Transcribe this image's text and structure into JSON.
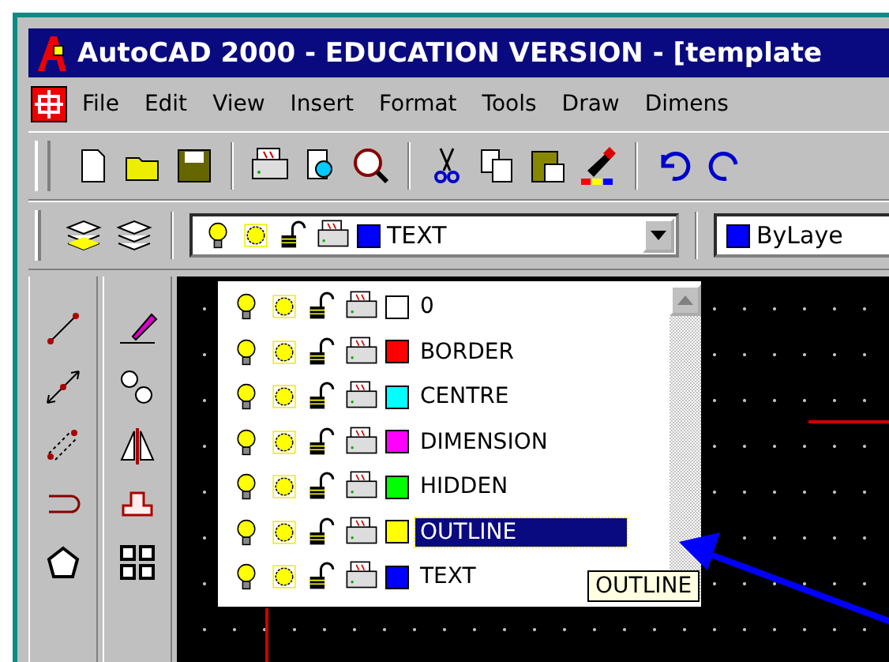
{
  "window": {
    "title": "AutoCAD 2000 - EDUCATION VERSION - [template"
  },
  "menu": [
    "File",
    "Edit",
    "View",
    "Insert",
    "Format",
    "Tools",
    "Draw",
    "Dimens"
  ],
  "layer_control": {
    "current": {
      "name": "TEXT",
      "color": "#0000ff"
    },
    "color_control": "ByLaye"
  },
  "layers": [
    {
      "name": "0",
      "color": "#ffffff",
      "selected": false
    },
    {
      "name": "BORDER",
      "color": "#ff0000",
      "selected": false
    },
    {
      "name": "CENTRE",
      "color": "#00ffff",
      "selected": false
    },
    {
      "name": "DIMENSION",
      "color": "#ff00ff",
      "selected": false
    },
    {
      "name": "HIDDEN",
      "color": "#00ff00",
      "selected": false
    },
    {
      "name": "OUTLINE",
      "color": "#ffff00",
      "selected": true
    },
    {
      "name": "TEXT",
      "color": "#0000ff",
      "selected": false
    }
  ],
  "tooltip": "OUTLINE"
}
